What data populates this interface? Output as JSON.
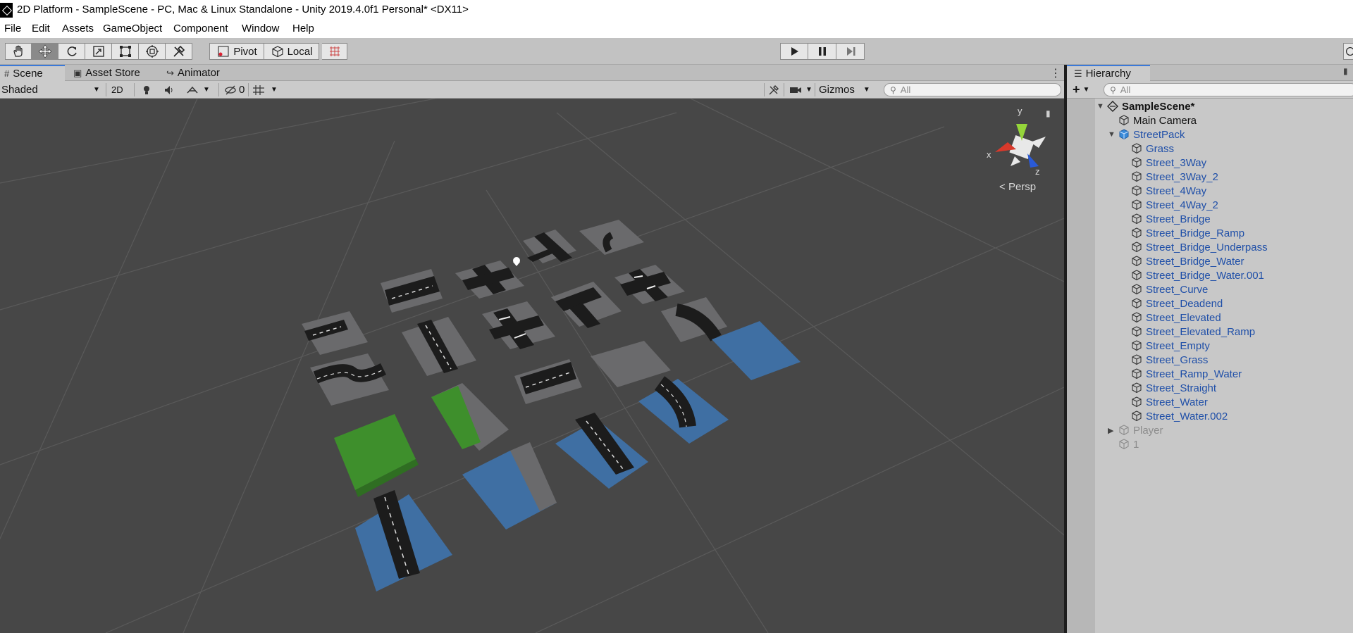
{
  "window": {
    "title": "2D Platform - SampleScene - PC, Mac & Linux Standalone - Unity 2019.4.0f1 Personal* <DX11>"
  },
  "menu": [
    "File",
    "Edit",
    "Assets",
    "GameObject",
    "Component",
    "Window",
    "Help"
  ],
  "toolbar": {
    "tools": [
      "hand-tool-icon",
      "move-tool-icon",
      "rotate-tool-icon",
      "scale-tool-icon",
      "rect-tool-icon",
      "transform-tool-icon",
      "custom-tool-icon"
    ],
    "active_tool": "move-tool-icon",
    "pivot_label": "Pivot",
    "local_label": "Local",
    "play_controls": [
      "play-icon",
      "pause-icon",
      "step-icon"
    ]
  },
  "scene": {
    "tabs": [
      {
        "label": "Scene",
        "icon": "grid-icon",
        "active": true
      },
      {
        "label": "Asset Store",
        "icon": "bag-icon",
        "active": false
      },
      {
        "label": "Animator",
        "icon": "animator-icon",
        "active": false
      }
    ],
    "shading_mode": "Shaded",
    "mode_2d": "2D",
    "hidden_count": "0",
    "gizmos_label": "Gizmos",
    "search_placeholder": "All",
    "view_label": "Persp",
    "gizmo_axes": {
      "x": "x",
      "y": "y",
      "z": "z"
    }
  },
  "hierarchy": {
    "tab_label": "Hierarchy",
    "search_placeholder": "All",
    "add_label": "+",
    "scene_name": "SampleScene*",
    "items": [
      {
        "label": "Main Camera",
        "depth": 1,
        "style": "norm",
        "icon": "gameobject-icon"
      },
      {
        "label": "StreetPack",
        "depth": 1,
        "style": "blue",
        "icon": "prefab-icon",
        "expanded": true
      },
      {
        "label": "Grass",
        "depth": 2,
        "style": "blue",
        "icon": "gameobject-icon"
      },
      {
        "label": "Street_3Way",
        "depth": 2,
        "style": "blue",
        "icon": "gameobject-icon"
      },
      {
        "label": "Street_3Way_2",
        "depth": 2,
        "style": "blue",
        "icon": "gameobject-icon"
      },
      {
        "label": "Street_4Way",
        "depth": 2,
        "style": "blue",
        "icon": "gameobject-icon"
      },
      {
        "label": "Street_4Way_2",
        "depth": 2,
        "style": "blue",
        "icon": "gameobject-icon"
      },
      {
        "label": "Street_Bridge",
        "depth": 2,
        "style": "blue",
        "icon": "gameobject-icon"
      },
      {
        "label": "Street_Bridge_Ramp",
        "depth": 2,
        "style": "blue",
        "icon": "gameobject-icon"
      },
      {
        "label": "Street_Bridge_Underpass",
        "depth": 2,
        "style": "blue",
        "icon": "gameobject-icon"
      },
      {
        "label": "Street_Bridge_Water",
        "depth": 2,
        "style": "blue",
        "icon": "gameobject-icon"
      },
      {
        "label": "Street_Bridge_Water.001",
        "depth": 2,
        "style": "blue",
        "icon": "gameobject-icon"
      },
      {
        "label": "Street_Curve",
        "depth": 2,
        "style": "blue",
        "icon": "gameobject-icon"
      },
      {
        "label": "Street_Deadend",
        "depth": 2,
        "style": "blue",
        "icon": "gameobject-icon"
      },
      {
        "label": "Street_Elevated",
        "depth": 2,
        "style": "blue",
        "icon": "gameobject-icon"
      },
      {
        "label": "Street_Elevated_Ramp",
        "depth": 2,
        "style": "blue",
        "icon": "gameobject-icon"
      },
      {
        "label": "Street_Empty",
        "depth": 2,
        "style": "blue",
        "icon": "gameobject-icon"
      },
      {
        "label": "Street_Grass",
        "depth": 2,
        "style": "blue",
        "icon": "gameobject-icon"
      },
      {
        "label": "Street_Ramp_Water",
        "depth": 2,
        "style": "blue",
        "icon": "gameobject-icon"
      },
      {
        "label": "Street_Straight",
        "depth": 2,
        "style": "blue",
        "icon": "gameobject-icon"
      },
      {
        "label": "Street_Water",
        "depth": 2,
        "style": "blue",
        "icon": "gameobject-icon"
      },
      {
        "label": "Street_Water.002",
        "depth": 2,
        "style": "blue",
        "icon": "gameobject-icon"
      },
      {
        "label": "Player",
        "depth": 1,
        "style": "gray",
        "icon": "gameobject-icon",
        "collapsed": true
      },
      {
        "label": "1",
        "depth": 1,
        "style": "gray",
        "icon": "gameobject-icon"
      }
    ]
  },
  "colors": {
    "viewport_bg": "#474747",
    "tile_gray": "#6a6a6c",
    "road": "#1c1c1c",
    "water": "#3f6fa3",
    "grass": "#3e8f2c",
    "hierarchy_link": "#1f4fa8",
    "active_tab_accent": "#3a79d9"
  }
}
